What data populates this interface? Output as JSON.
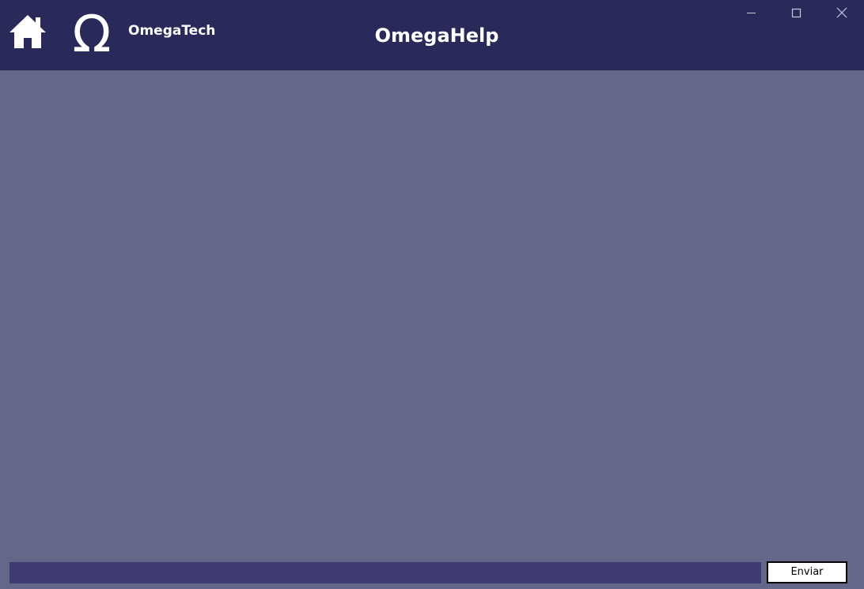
{
  "window": {
    "brand_name": "OmegaTech",
    "title": "OmegaHelp",
    "logo_glyph": "Ω",
    "controls": {
      "minimize_icon": "minimize-icon",
      "maximize_icon": "maximize-icon",
      "close_icon": "close-icon"
    }
  },
  "header": {
    "home_icon": "home-icon",
    "logo_icon": "omega-icon"
  },
  "composer": {
    "input_value": "",
    "send_label": "Enviar"
  },
  "colors": {
    "titlebar": "#2a2a5a",
    "background": "#64668a",
    "input_background": "#3e3c70",
    "button_background": "#ffffff",
    "text_light": "#ffffff"
  }
}
